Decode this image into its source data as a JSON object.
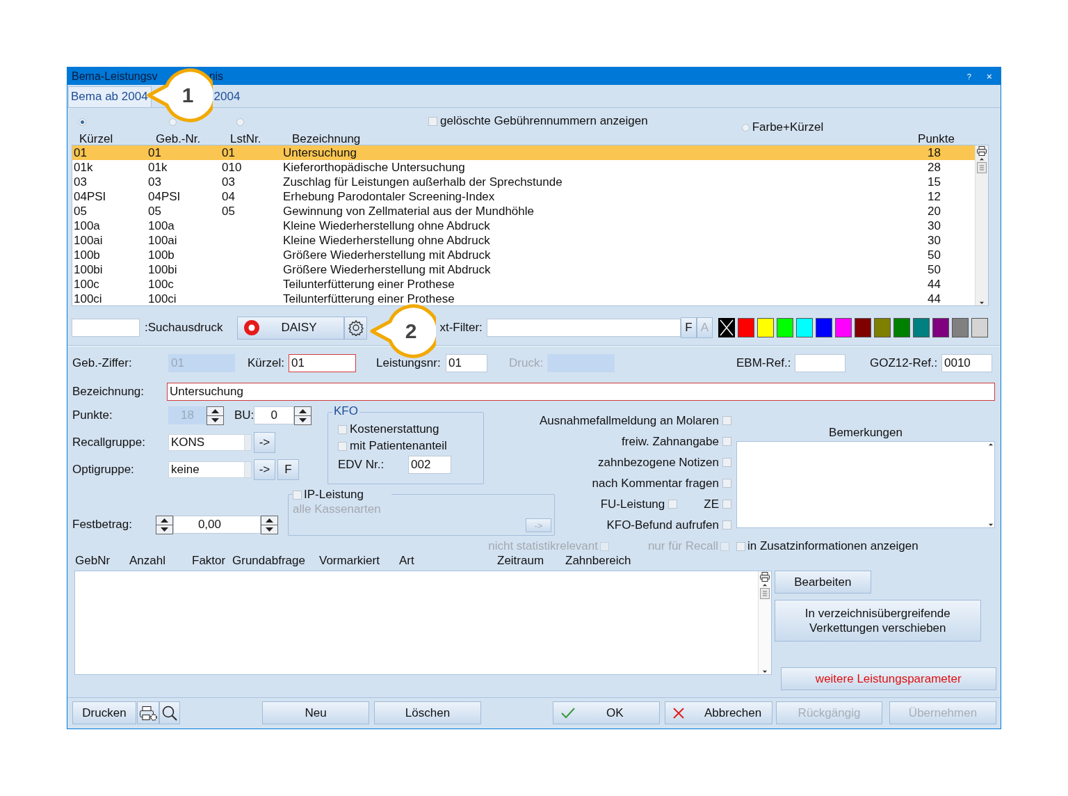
{
  "window": {
    "title_parts": [
      "Bema-Leistungsv",
      "nis"
    ],
    "help": "?",
    "close": "×"
  },
  "callouts": [
    {
      "number": "1"
    },
    {
      "number": "2"
    }
  ],
  "tabs": [
    {
      "label": "Bema ab 2004",
      "selected": true
    },
    {
      "label": "2004",
      "selected": false
    }
  ],
  "view_options": {
    "radios": [
      {
        "selected": true
      },
      {
        "selected": false
      },
      {
        "selected": false
      }
    ],
    "show_deleted": {
      "label": "gelöschte Gebührennummern anzeigen",
      "checked": false
    },
    "color_mode": {
      "label": "Farbe+Kürzel",
      "selected": false
    }
  },
  "list": {
    "columns": [
      "Kürzel",
      "Geb.-Nr.",
      "LstNr.",
      "Bezeichnung",
      "Punkte"
    ],
    "rows": [
      {
        "cells": [
          "01",
          "01",
          "01",
          "Untersuchung",
          "18"
        ],
        "selected": true
      },
      {
        "cells": [
          "01k",
          "01k",
          "010",
          "Kieferorthopädische Untersuchung",
          "28"
        ],
        "selected": false
      },
      {
        "cells": [
          "03",
          "03",
          "03",
          "Zuschlag für Leistungen außerhalb der Sprechstunde",
          "15"
        ],
        "selected": false
      },
      {
        "cells": [
          "04PSI",
          "04PSI",
          "04",
          "Erhebung Parodontaler Screening-Index",
          "12"
        ],
        "selected": false
      },
      {
        "cells": [
          "05",
          "05",
          "05",
          "Gewinnung von Zellmaterial aus der Mundhöhle",
          "20"
        ],
        "selected": false
      },
      {
        "cells": [
          "100a",
          "100a",
          "",
          "Kleine Wiederherstellung ohne Abdruck",
          "30"
        ],
        "selected": false
      },
      {
        "cells": [
          "100ai",
          "100ai",
          "",
          "Kleine Wiederherstellung ohne Abdruck",
          "30"
        ],
        "selected": false
      },
      {
        "cells": [
          "100b",
          "100b",
          "",
          "Größere Wiederherstellung mit Abdruck",
          "50"
        ],
        "selected": false
      },
      {
        "cells": [
          "100bi",
          "100bi",
          "",
          "Größere Wiederherstellung mit Abdruck",
          "50"
        ],
        "selected": false
      },
      {
        "cells": [
          "100c",
          "100c",
          "",
          "Teilunterfütterung einer Prothese",
          "44"
        ],
        "selected": false
      },
      {
        "cells": [
          "100ci",
          "100ci",
          "",
          "Teilunterfütterung einer Prothese",
          "44"
        ],
        "selected": false
      }
    ]
  },
  "toolbar": {
    "search_label": ":Suchausdruck",
    "daisy": "DAISY",
    "filter_label": "xt-Filter:",
    "filter_buttons": [
      {
        "label": "F",
        "disabled": false
      },
      {
        "label": "A",
        "disabled": true
      }
    ],
    "colors": [
      {
        "color": "#000000",
        "kind": "crossed"
      },
      {
        "color": "#ff0000",
        "kind": "plain"
      },
      {
        "color": "#ffff00",
        "kind": "plain"
      },
      {
        "color": "#00ff00",
        "kind": "plain"
      },
      {
        "color": "#00ffff",
        "kind": "plain"
      },
      {
        "color": "#0000ff",
        "kind": "plain"
      },
      {
        "color": "#ff00ff",
        "kind": "plain"
      },
      {
        "color": "#800000",
        "kind": "plain"
      },
      {
        "color": "#808000",
        "kind": "plain"
      },
      {
        "color": "#008000",
        "kind": "plain"
      },
      {
        "color": "#008080",
        "kind": "plain"
      },
      {
        "color": "#800080",
        "kind": "plain"
      },
      {
        "color": "#808080",
        "kind": "plain"
      },
      {
        "color": "#d4d4d4",
        "kind": "plain"
      }
    ]
  },
  "ref_fields": [
    {
      "label": "Geb.-Ziffer:",
      "value": "01",
      "disabled": true,
      "highlighted": false
    },
    {
      "label": "Kürzel:",
      "value": "01",
      "disabled": false,
      "highlighted": true
    },
    {
      "label": "Leistungsnr:",
      "value": "01",
      "disabled": false,
      "highlighted": false
    },
    {
      "label": "Druck:",
      "disabled": true,
      "highlighted": false
    },
    {
      "label": "EBM-Ref.:",
      "disabled": false,
      "highlighted": false
    },
    {
      "label": "GOZ12-Ref.:",
      "value": "0010",
      "disabled": false,
      "highlighted": false
    }
  ],
  "bezeichnung": {
    "label": "Bezeichnung:",
    "value": "Untersuchung",
    "highlighted": true
  },
  "punkte": {
    "label": "Punkte:",
    "value": "18",
    "disabled": true
  },
  "bu": {
    "label": "BU:",
    "value": "0"
  },
  "recall": {
    "label": "Recallgruppe:",
    "value": "KONS",
    "buttons": [
      "->"
    ]
  },
  "opti": {
    "label": "Optigruppe:",
    "value": "keine",
    "buttons": [
      "->",
      "F"
    ]
  },
  "festbetrag": {
    "label": "Festbetrag:",
    "value": "0,00"
  },
  "kfo": {
    "title": "KFO",
    "checks": [
      {
        "label": "Kostenerstattung",
        "checked": false
      },
      {
        "label": "mit Patientenanteil",
        "checked": false
      }
    ],
    "edv": {
      "label": "EDV Nr.:",
      "value": "002"
    }
  },
  "ip": {
    "label": "IP-Leistung",
    "checked": false,
    "subtitle": "alle Kassenarten",
    "button": {
      "label": "->",
      "disabled": true
    }
  },
  "flags": [
    [
      {
        "label": "Ausnahmefallmeldung an Molaren",
        "checked": false
      }
    ],
    [
      {
        "label": "freiw. Zahnangabe",
        "checked": false
      }
    ],
    [
      {
        "label": "zahnbezogene Notizen",
        "checked": false
      }
    ],
    [
      {
        "label": "nach Kommentar fragen",
        "checked": false
      }
    ],
    [
      {
        "label": "FU-Leistung",
        "checked": false
      },
      {
        "label": "ZE",
        "checked": false
      }
    ],
    [
      {
        "label": "KFO-Befund aufrufen",
        "checked": false
      }
    ]
  ],
  "bemerkungen": {
    "label": "Bemerkungen"
  },
  "options": [
    {
      "label": "nicht statistikrelevant",
      "checked": false,
      "disabled": true
    },
    {
      "label": "nur für Recall",
      "checked": false,
      "disabled": true
    },
    {
      "label": "in Zusatzinformationen anzeigen",
      "checked": false,
      "disabled": false
    }
  ],
  "links": {
    "columns": [
      "GebNr",
      "Anzahl",
      "Faktor",
      "Grundabfrage",
      "Vormarkiert",
      "Art",
      "Zeitraum",
      "Zahnbereich"
    ]
  },
  "side_buttons": [
    {
      "label": "Bearbeiten",
      "highlighted": false
    },
    {
      "label": "In verzeichnisübergreifende Verkettungen verschieben",
      "highlighted": false
    },
    {
      "label": "weitere Leistungsparameter",
      "highlighted": true
    }
  ],
  "footer": [
    {
      "kind": "text",
      "label": "Drucken",
      "disabled": false
    },
    {
      "kind": "print-settings",
      "disabled": false
    },
    {
      "kind": "search",
      "disabled": false
    },
    {
      "kind": "text",
      "label": "Neu",
      "disabled": false
    },
    {
      "kind": "text",
      "label": "Löschen",
      "disabled": false
    },
    {
      "kind": "ok",
      "label": "OK",
      "disabled": false
    },
    {
      "kind": "cancel",
      "label": "Abbrechen",
      "disabled": false
    },
    {
      "kind": "text",
      "label": "Rückgängig",
      "disabled": true
    },
    {
      "kind": "text",
      "label": "Übernehmen",
      "disabled": true
    }
  ]
}
